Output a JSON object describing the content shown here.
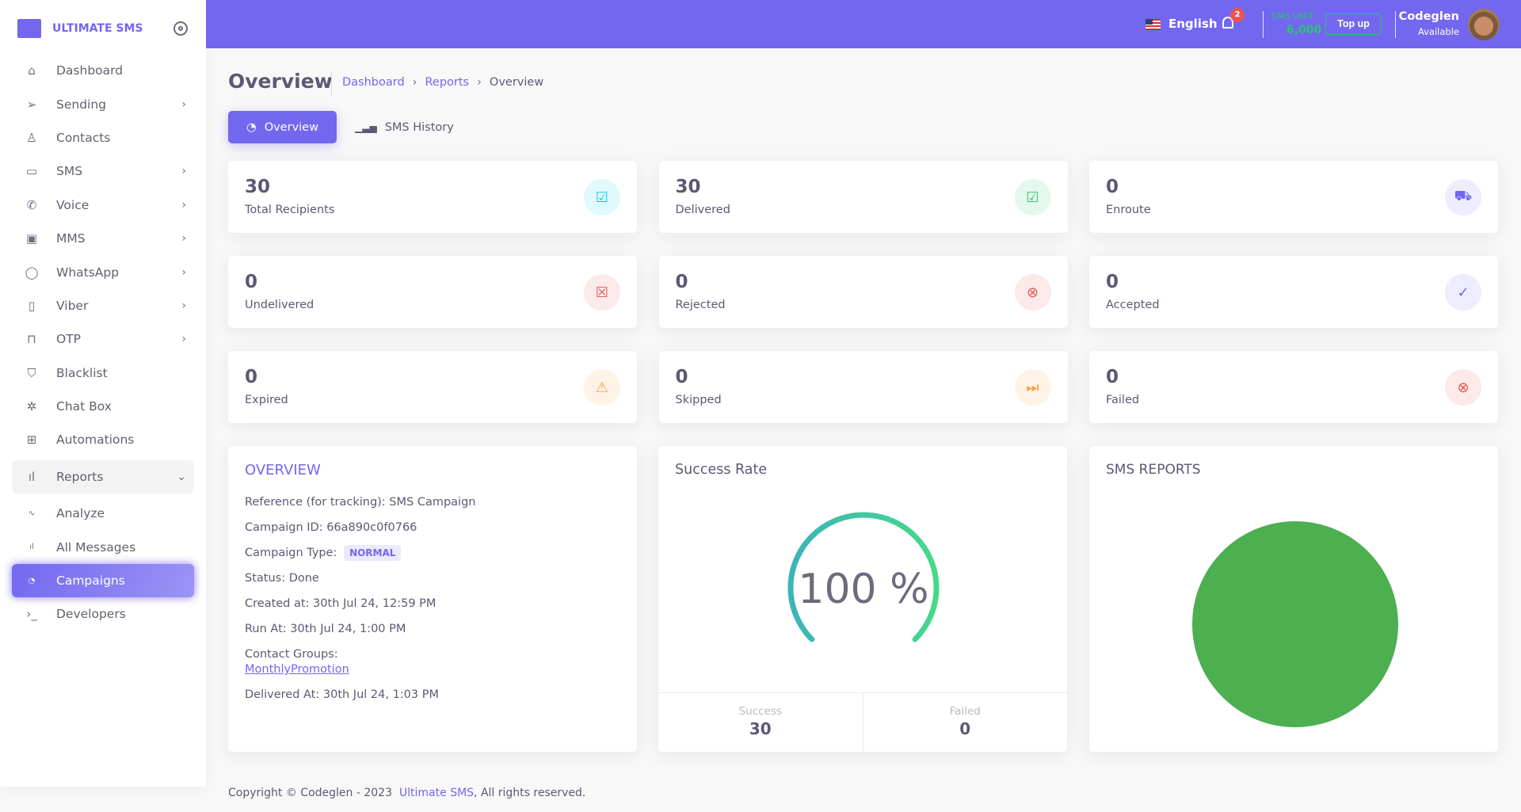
{
  "brand": {
    "name": "ULTIMATE SMS"
  },
  "sidebar": {
    "items": [
      {
        "label": "Dashboard",
        "icon": "home-icon"
      },
      {
        "label": "Sending",
        "icon": "send-icon",
        "has_children": true
      },
      {
        "label": "Contacts",
        "icon": "user-icon"
      },
      {
        "label": "SMS",
        "icon": "message-square-icon",
        "has_children": true
      },
      {
        "label": "Voice",
        "icon": "phone-call-icon",
        "has_children": true
      },
      {
        "label": "MMS",
        "icon": "image-icon",
        "has_children": true
      },
      {
        "label": "WhatsApp",
        "icon": "message-circle-icon",
        "has_children": true
      },
      {
        "label": "Viber",
        "icon": "smartphone-icon",
        "has_children": true
      },
      {
        "label": "OTP",
        "icon": "unlock-icon",
        "has_children": true
      },
      {
        "label": "Blacklist",
        "icon": "shield-icon"
      },
      {
        "label": "Chat Box",
        "icon": "chat-icon"
      },
      {
        "label": "Automations",
        "icon": "cpu-icon"
      },
      {
        "label": "Reports",
        "icon": "bar-chart-icon",
        "expanded": true
      },
      {
        "label": "Analyze",
        "icon": "activity-icon"
      },
      {
        "label": "All Messages",
        "icon": "bar-chart-icon"
      },
      {
        "label": "Campaigns",
        "icon": "pie-chart-icon",
        "active": true
      },
      {
        "label": "Developers",
        "icon": "terminal-icon"
      }
    ]
  },
  "topbar": {
    "language": "English",
    "notifications": "2",
    "sms_unit_label": "SMS UNIT",
    "sms_unit_value": "6,000",
    "topup": "Top up",
    "user_name": "Codeglen",
    "user_status": "Available"
  },
  "page": {
    "title": "Overview",
    "breadcrumb": [
      "Dashboard",
      "Reports",
      "Overview"
    ]
  },
  "tabs": [
    {
      "label": "Overview",
      "active": true
    },
    {
      "label": "SMS History"
    }
  ],
  "stats": [
    {
      "value": "30",
      "label": "Total Recipients",
      "color": "#00cfe8",
      "icon": "check-square-icon"
    },
    {
      "value": "30",
      "label": "Delivered",
      "color": "#28c76f",
      "icon": "check-square-icon"
    },
    {
      "value": "0",
      "label": "Enroute",
      "color": "#7367f0",
      "icon": "truck-icon"
    },
    {
      "value": "0",
      "label": "Undelivered",
      "color": "#ea5455",
      "icon": "x-square-icon"
    },
    {
      "value": "0",
      "label": "Rejected",
      "color": "#ea5455",
      "icon": "x-circle-icon"
    },
    {
      "value": "0",
      "label": "Accepted",
      "color": "#7367f0",
      "icon": "check-circle-icon"
    },
    {
      "value": "0",
      "label": "Expired",
      "color": "#ff9f43",
      "icon": "alert-triangle-icon"
    },
    {
      "value": "0",
      "label": "Skipped",
      "color": "#ff9f43",
      "icon": "skip-forward-icon"
    },
    {
      "value": "0",
      "label": "Failed",
      "color": "#ea5455",
      "icon": "x-circle-icon"
    }
  ],
  "overview": {
    "title": "OVERVIEW",
    "reference": "Reference (for tracking): SMS Campaign",
    "campaign_id": "Campaign ID: 66a890c0f0766",
    "type_label": "Campaign Type:",
    "type_value": "NORMAL",
    "status": "Status: Done",
    "created": "Created at: 30th Jul 24, 12:59 PM",
    "run": "Run At: 30th Jul 24, 1:00 PM",
    "groups_label": "Contact Groups:",
    "groups_value": "MonthlyPromotion",
    "delivered": "Delivered At: 30th Jul 24, 1:03 PM"
  },
  "success_rate": {
    "title": "Success Rate",
    "percent_text": "100 %",
    "percent": 100,
    "success_label": "Success",
    "success_value": "30",
    "failed_label": "Failed",
    "failed_value": "0",
    "colors": [
      "#3bb4b8",
      "#46d98a"
    ]
  },
  "sms_reports": {
    "title": "SMS REPORTS",
    "color": "#4caf50"
  },
  "footer": {
    "prefix": "Copyright © Codeglen - 2023",
    "link": "Ultimate SMS",
    "suffix": ", All rights reserved."
  }
}
